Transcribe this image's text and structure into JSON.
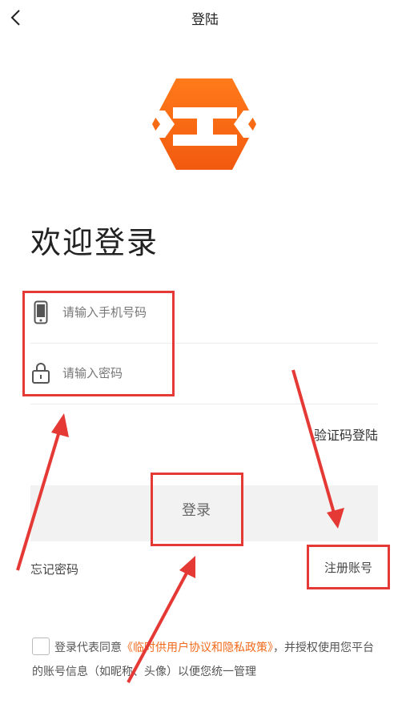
{
  "nav": {
    "title": "登陆"
  },
  "welcome": "欢迎登录",
  "form": {
    "phone_placeholder": "请输入手机号码",
    "password_placeholder": "请输入密码"
  },
  "links": {
    "sms_login": "验证码登陆",
    "forgot": "忘记密码",
    "register": "注册账号"
  },
  "login_button": "登录",
  "agreement": {
    "prefix": "登录代表同意",
    "policy": "《临时供用户协议和隐私政策》",
    "suffix": "，并授权使用您平台的账号信息（如昵称、头像）以便您统一管理"
  },
  "colors": {
    "brand": "#f26a1c",
    "annotation": "#e53935"
  }
}
